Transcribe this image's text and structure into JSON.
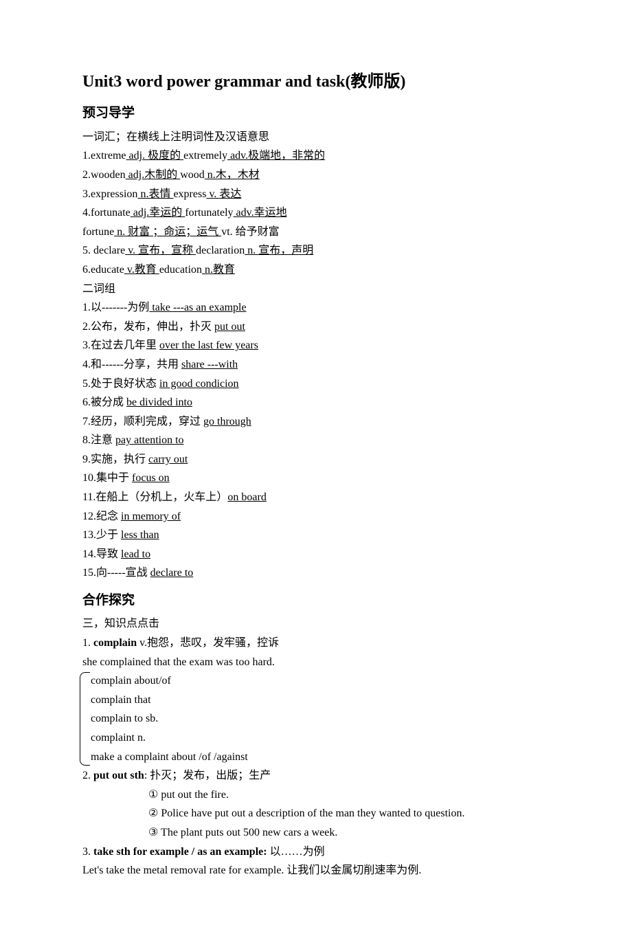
{
  "title": "Unit3 word power grammar and task(教师版)",
  "section1": {
    "heading": "预习导学",
    "intro": "一词汇；在横线上注明词性及汉语意思",
    "items": [
      {
        "num": "1.extreme",
        "u1": " adj. 极度的 ",
        "mid": "extremely",
        "u2": "    adv.极端地，非常的  "
      },
      {
        "num": "2.wooden",
        "u1": " adj.木制的 ",
        "mid": "wood",
        "u2": "   n.木，木材"
      },
      {
        "num": "3.expression",
        "u1": " n.表情 ",
        "mid": "express",
        "u2": "   v.  表达"
      },
      {
        "num": "4.fortunate",
        "u1": "   adj.幸运的 ",
        "mid": "fortunately",
        "u2": " adv.幸运地"
      },
      {
        "sub": "   fortune",
        "u1": "   n.   财富  ；命运；运气 ",
        "mid": "vt. 给予财富"
      },
      {
        "num": "5.    declare",
        "u1": "    v.  宣布，宣称 ",
        "mid": "declaration",
        "u2": "   n.  宣布，声明"
      },
      {
        "num": "6.educate",
        "u1": " v.教育 ",
        "mid": "education",
        "u2": "    n.教育"
      }
    ],
    "intro2": "二词组",
    "phrases": [
      {
        "num": "1.以-------为例",
        "u": " take ---as an example "
      },
      {
        "num": "2.公布，发布，伸出，扑灭 ",
        "u": "put out "
      },
      {
        "num": "3.在过去几年里 ",
        "u": "over the last few years "
      },
      {
        "num": "4.和------分享，共用 ",
        "u": "share ---with"
      },
      {
        "num": "5.处于良好状态 ",
        "u": "in good condicion"
      },
      {
        "num": "6.被分成 ",
        "u": "be divided into "
      },
      {
        "num": "7.经历，顺利完成，穿过 ",
        "u": "go through"
      },
      {
        "num": "8.注意 ",
        "u": "pay attention to "
      },
      {
        "num": "9.实施，执行 ",
        "u": "carry out "
      },
      {
        "num": "10.集中于 ",
        "u": "focus on"
      },
      {
        "num": "11.在船上（分机上，火车上）",
        "u": "on board"
      },
      {
        "num": "12.纪念 ",
        "u": "in memory of "
      },
      {
        "num": "13.少于 ",
        "u": "less than"
      },
      {
        "num": "14.导致 ",
        "u": "lead to "
      },
      {
        "num": "15.向-----宣战 ",
        "u": "declare to "
      }
    ]
  },
  "section2": {
    "heading": "合作探究",
    "intro": "三，知识点点击",
    "k1": {
      "header_prefix": "1.    ",
      "header_bold": "complain",
      "header_suffix": " v.抱怨，悲叹，发牢骚，控诉",
      "example": "she complained that the exam was too hard.",
      "brace": [
        "complain    about/of",
        "complain that",
        "complain to sb.",
        "complaint n.",
        "make a complaint about /of /against"
      ]
    },
    "k2": {
      "header_prefix": " 2. ",
      "header_bold": "put out sth",
      "header_suffix": ":  扑灭；发布，出版；生产",
      "ex1": "① put out the fire.",
      "ex2": "② Police have put out a description of the man they wanted to question.",
      "ex3": "③ The plant puts out 500 new cars a week."
    },
    "k3": {
      "header_prefix": " 3. ",
      "header_bold": "take sth for example / as an example:",
      "header_suffix": "  以……为例",
      "ex": "    Let's take the metal removal rate for example.  让我们以金属切削速率为例."
    }
  }
}
